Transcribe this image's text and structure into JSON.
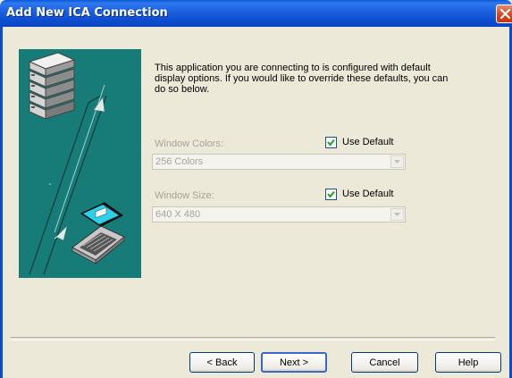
{
  "window": {
    "title": "Add New ICA Connection"
  },
  "content": {
    "intro": "This application you are connecting to is configured with default display options.  If you would like to override these defaults, you can do so below."
  },
  "window_colors": {
    "label": "Window Colors:",
    "use_default_label": "Use Default",
    "checked": true,
    "value": "256 Colors"
  },
  "window_size": {
    "label": "Window Size:",
    "use_default_label": "Use Default",
    "checked": true,
    "value": "640 X 480"
  },
  "buttons": {
    "back": "< Back",
    "next": "Next >",
    "cancel": "Cancel",
    "help": "Help"
  },
  "colors": {
    "titlebar": "#0b4ccc",
    "panel": "#177b78",
    "dialog_bg": "#ece9d8"
  }
}
